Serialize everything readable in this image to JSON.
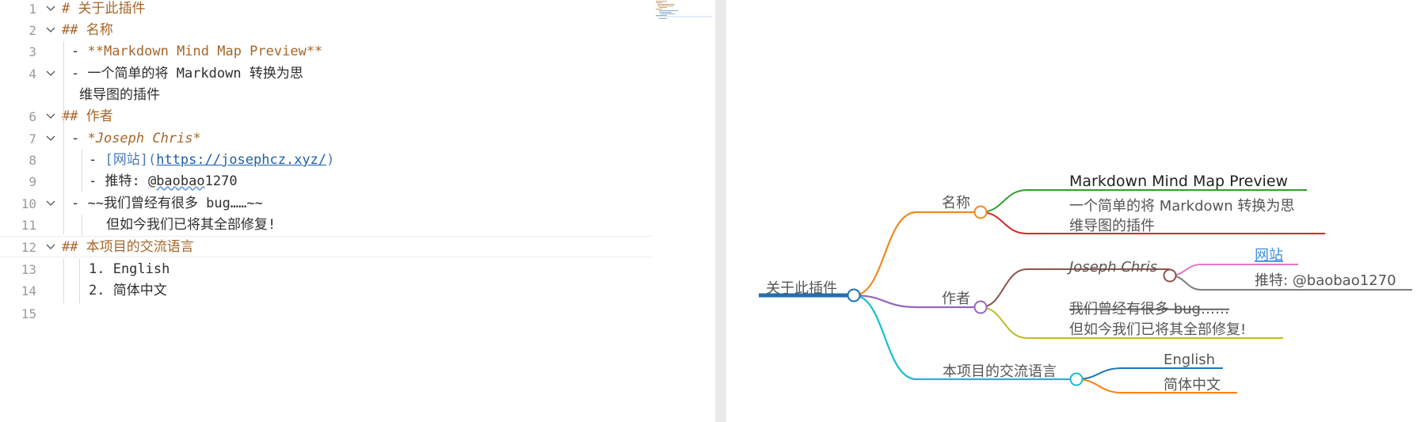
{
  "editor": {
    "lines": [
      {
        "num": "1",
        "segments": [
          {
            "t": "# 关于此插件",
            "cls": "heading"
          }
        ]
      },
      {
        "num": "2",
        "segments": [
          {
            "t": "## 名称",
            "cls": "heading"
          }
        ]
      },
      {
        "num": "3",
        "segments": [
          {
            "t": "- ",
            "cls": ""
          },
          {
            "t": "**Markdown Mind Map Preview**",
            "cls": "bold"
          }
        ]
      },
      {
        "num": "4",
        "segments": [
          {
            "t": "- 一个简单的将 Markdown 转换为思",
            "cls": ""
          }
        ]
      },
      {
        "num": "",
        "segments": [
          {
            "t": "维导图的插件",
            "cls": ""
          }
        ]
      },
      {
        "num": "6",
        "segments": [
          {
            "t": "## 作者",
            "cls": "heading"
          }
        ]
      },
      {
        "num": "7",
        "segments": [
          {
            "t": "- ",
            "cls": ""
          },
          {
            "t": "*Joseph Chris*",
            "cls": "italic"
          }
        ]
      },
      {
        "num": "8",
        "segments": [
          {
            "t": "- ",
            "cls": ""
          },
          {
            "t": "[网站](",
            "cls": "link-text"
          },
          {
            "t": "https://josephcz.xyz/",
            "cls": "url"
          },
          {
            "t": ")",
            "cls": "link-text"
          }
        ]
      },
      {
        "num": "9",
        "segments": [
          {
            "t": "- 推特: ",
            "cls": ""
          },
          {
            "t": "@baobao",
            "cls": "squig"
          },
          {
            "t": "1270",
            "cls": ""
          }
        ]
      },
      {
        "num": "10",
        "segments": [
          {
            "t": "- ~~我们曾经有很多 bug……~~",
            "cls": ""
          }
        ]
      },
      {
        "num": "11",
        "segments": [
          {
            "t": "但如今我们已将其全部修复!",
            "cls": ""
          }
        ]
      },
      {
        "num": "12",
        "segments": [
          {
            "t": "## 本项目的交流语言",
            "cls": "heading"
          }
        ]
      },
      {
        "num": "13",
        "segments": [
          {
            "t": "1. English",
            "cls": ""
          }
        ]
      },
      {
        "num": "14",
        "segments": [
          {
            "t": "2. 简体中文",
            "cls": ""
          }
        ]
      },
      {
        "num": "15",
        "segments": []
      }
    ]
  },
  "mindmap": {
    "root": "关于此插件",
    "branch_name": "名称",
    "name_title": "Markdown Mind Map Preview",
    "name_desc_1": "一个简单的将 Markdown 转换为思",
    "name_desc_2": "维导图的插件",
    "branch_author": "作者",
    "author_name": "Joseph Chris",
    "author_site": "网站",
    "author_twitter": "推特: @baobao1270",
    "bugs_strike": "我们曾经有很多 bug……",
    "bugs_fixed": "但如今我们已将其全部修复!",
    "branch_lang": "本项目的交流语言",
    "lang_1": "English",
    "lang_2": "简体中文"
  },
  "colors": {
    "root": "#1f6fb2",
    "name_branch": "#f0891f",
    "name_title_line": "#2ca02c",
    "name_desc_line": "#d62728",
    "author_branch": "#9467bd",
    "author_name_line": "#8c564b",
    "site_line": "#e377c2",
    "twitter_line": "#7f7f7f",
    "bugs_line": "#bcbd22",
    "lang_branch": "#17becf",
    "english_line": "#1f77b4",
    "chinese_line": "#ff7f0e"
  }
}
